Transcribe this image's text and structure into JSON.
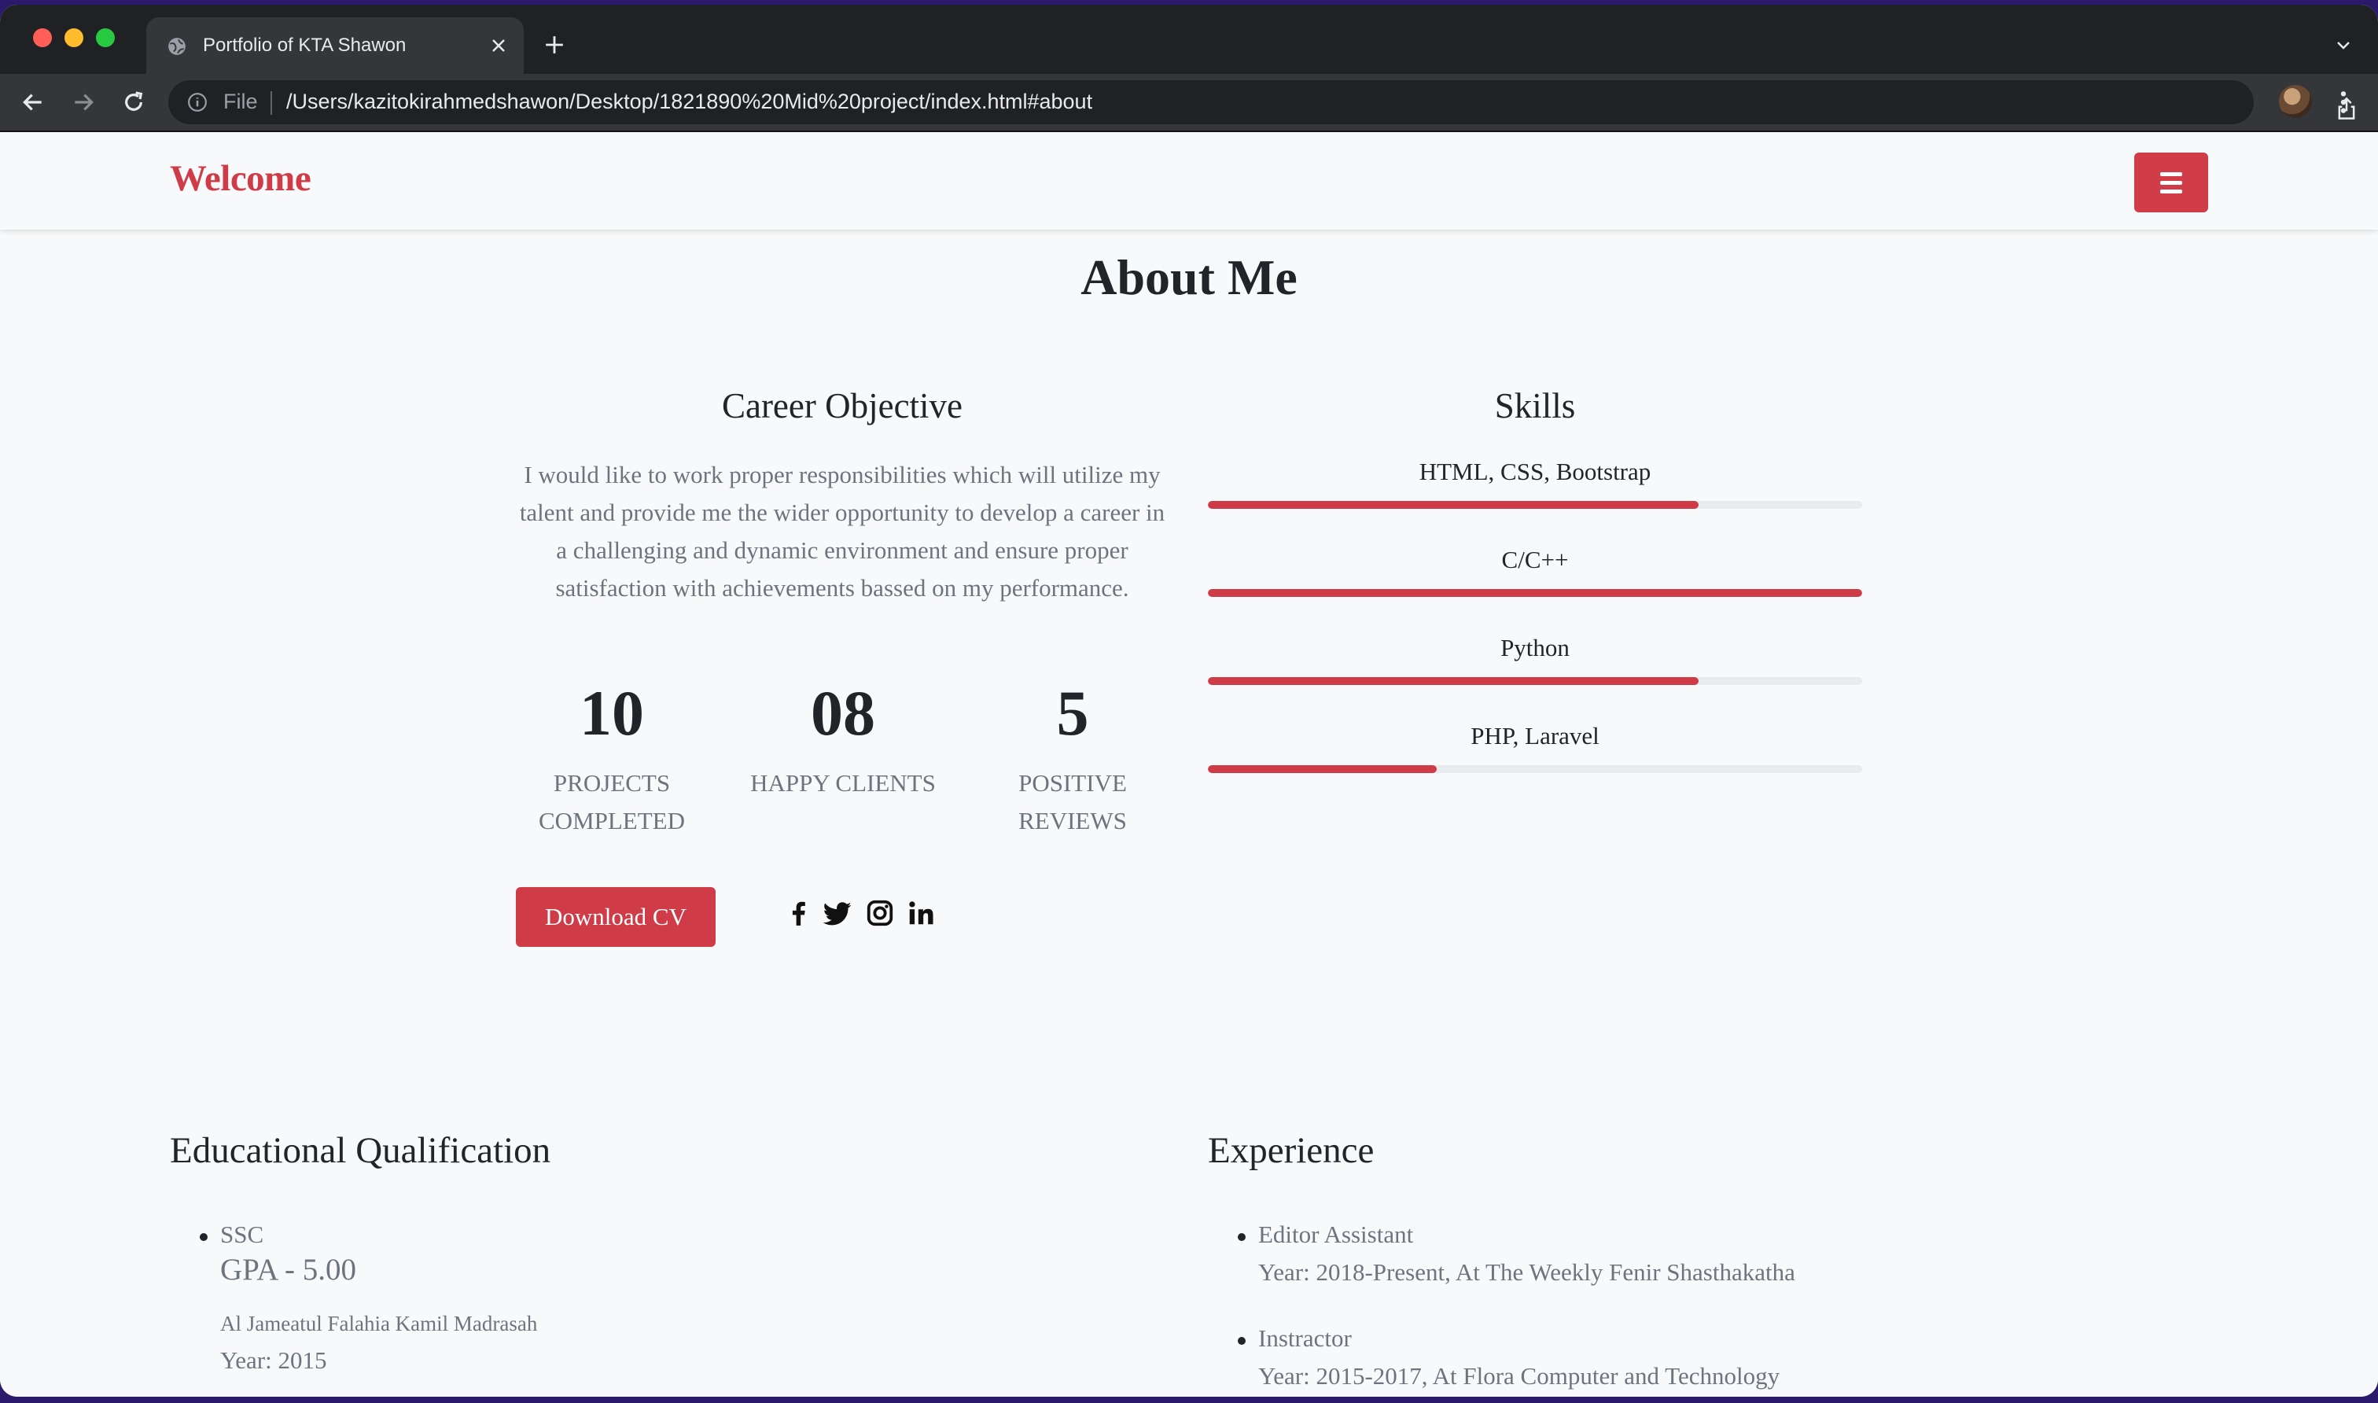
{
  "browser": {
    "tab_title": "Portfolio of KTA Shawon",
    "scheme_label": "File",
    "url": "/Users/kazitokirahmedshawon/Desktop/1821890%20Mid%20project/index.html#about"
  },
  "nav": {
    "brand": "Welcome"
  },
  "about": {
    "title": "About Me",
    "objective": {
      "title": "Career Objective",
      "text": "I would like to work proper responsibilities which will utilize my talent and provide me the wider opportunity to develop a career in a challenging and dynamic environment and ensure proper satisfaction with achievements bassed on my performance."
    },
    "stats": [
      {
        "value": "10",
        "label": "PROJECTS COMPLETED"
      },
      {
        "value": "08",
        "label": "HAPPY CLIENTS"
      },
      {
        "value": "5",
        "label": "POSITIVE REVIEWS"
      }
    ],
    "download_cv": "Download CV",
    "social_icons": [
      "facebook-icon",
      "twitter-icon",
      "instagram-icon",
      "linkedin-icon"
    ],
    "skills": {
      "title": "Skills",
      "items": [
        {
          "label": "HTML, CSS, Bootstrap",
          "level": 0.75
        },
        {
          "label": "C/C++",
          "level": 1.0
        },
        {
          "label": "Python",
          "level": 0.75
        },
        {
          "label": "PHP, Laravel",
          "level": 0.35
        }
      ]
    }
  },
  "education": {
    "title": "Educational Qualification",
    "items": [
      {
        "name": "SSC",
        "gpa": "GPA - 5.00",
        "institution": "Al Jameatul Falahia Kamil Madrasah",
        "year": "Year: 2015"
      }
    ]
  },
  "experience": {
    "title": "Experience",
    "items": [
      {
        "role": "Editor Assistant",
        "detail": "Year: 2018-Present, At The Weekly Fenir Shasthakatha"
      },
      {
        "role": "Instractor",
        "detail": "Year: 2015-2017, At Flora Computer and Technology"
      }
    ]
  },
  "colors": {
    "accent": "#cf3c48",
    "page_bg": "#f8f9fa",
    "chrome": "#35363a"
  }
}
